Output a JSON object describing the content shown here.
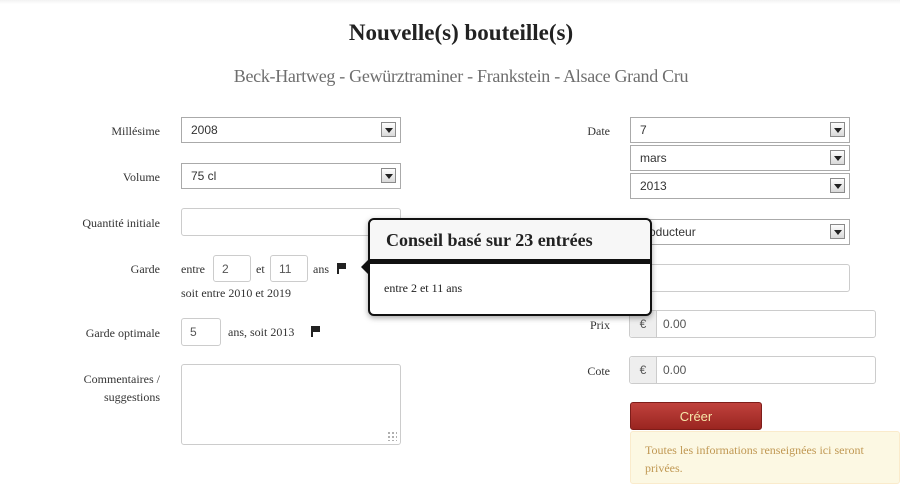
{
  "page": {
    "title": "Nouvelle(s) bouteille(s)",
    "subtitle": "Beck-Hartweg - Gewürztraminer - Frankstein - Alsace Grand Cru"
  },
  "form_left": {
    "millesime_label": "Millésime",
    "millesime_value": "2008",
    "volume_label": "Volume",
    "volume_value": "75 cl",
    "quantite_label": "Quantité initiale",
    "quantite_value": "",
    "garde_label": "Garde",
    "garde_entre": "entre",
    "garde_min": "2",
    "garde_et": "et",
    "garde_max": "11",
    "garde_ans": "ans",
    "garde_soit": "soit entre 2010 et 2019",
    "garde_opt_label": "Garde optimale",
    "garde_opt_value": "5",
    "garde_opt_suffix": "ans, soit 2013",
    "comments_label_1": "Commentaires /",
    "comments_label_2": "suggestions",
    "comments_value": ""
  },
  "form_right": {
    "date_label": "Date",
    "date_day": "7",
    "date_month": "mars",
    "date_year": "2013",
    "producer_select": "oducteur",
    "prix_label": "Prix",
    "prix_currency": "€",
    "prix_value": "0.00",
    "cote_label": "Cote",
    "cote_currency": "€",
    "cote_value": "0.00",
    "create_button": "Créer",
    "privacy_notice": "Toutes les informations renseignées ici seront privées."
  },
  "popover": {
    "title": "Conseil basé sur 23 entrées",
    "content": "entre 2 et 11 ans"
  },
  "colors": {
    "button_bg": "#a92f2a",
    "button_text": "#f6e6a8",
    "alert_bg": "#fcf8e3",
    "alert_text": "#c09853"
  },
  "icons": [
    "flag-icon",
    "dropdown-arrow-icon",
    "resize-grip-icon"
  ]
}
